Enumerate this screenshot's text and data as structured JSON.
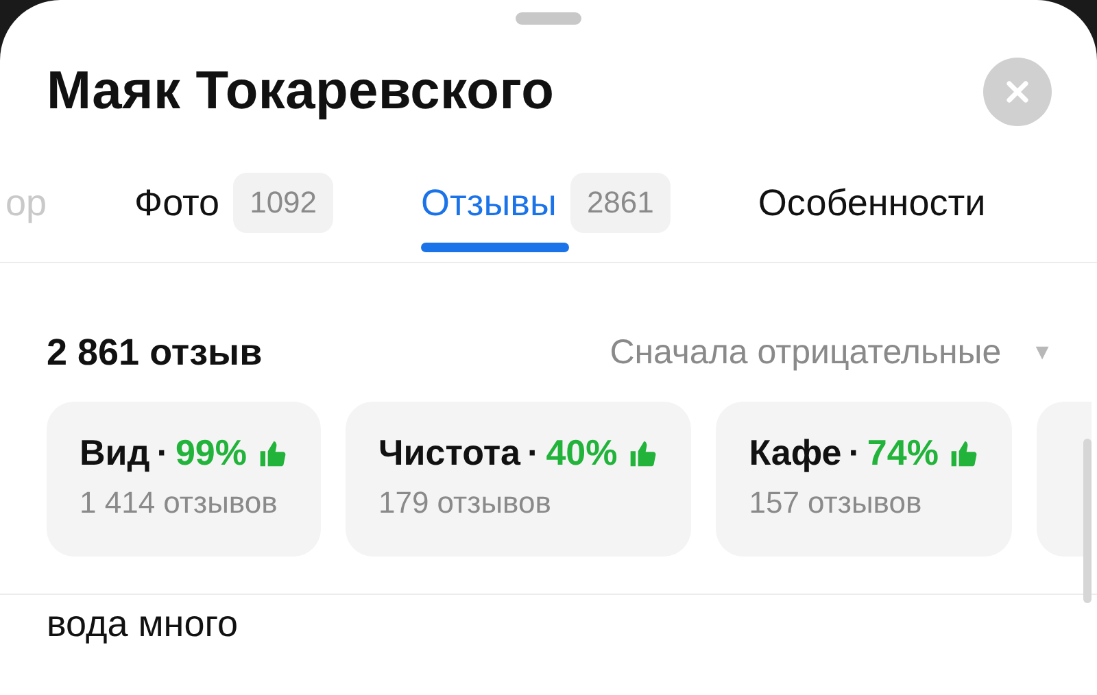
{
  "title": "Маяк Токаревского",
  "tabs": [
    {
      "label": "ор",
      "selected": false,
      "faded": true
    },
    {
      "label": "Фото",
      "count": "1092",
      "selected": false,
      "faded": false
    },
    {
      "label": "Отзывы",
      "count": "2861",
      "selected": true,
      "faded": false
    },
    {
      "label": "Особенности",
      "selected": false,
      "faded": false
    }
  ],
  "reviews": {
    "total": "2 861 отзыв",
    "sort": "Сначала отрицательные",
    "sort_arrow": "▼",
    "aspects": [
      {
        "name": "Вид",
        "separator": "·",
        "percent": "99%",
        "count": "1 414 отзывов"
      },
      {
        "name": "Чистота",
        "separator": "·",
        "percent": "40%",
        "count": "179 отзывов"
      },
      {
        "name": "Кафе",
        "separator": "·",
        "percent": "74%",
        "count": "157 отзывов"
      }
    ],
    "first_review_text": "вода много"
  }
}
